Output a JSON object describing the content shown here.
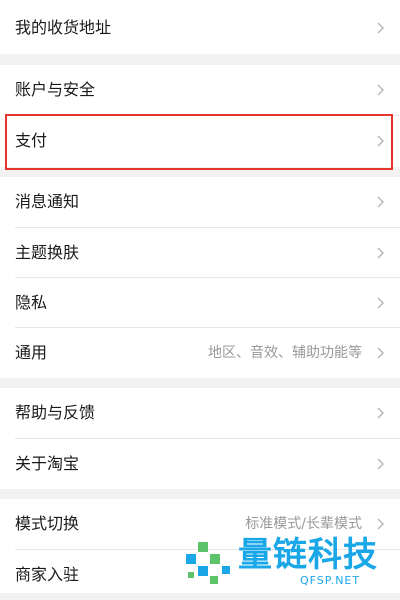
{
  "settings": {
    "groups": [
      {
        "items": [
          {
            "label": "我的收货地址",
            "value": ""
          }
        ]
      },
      {
        "items": [
          {
            "label": "账户与安全",
            "value": ""
          },
          {
            "label": "支付",
            "value": ""
          }
        ]
      },
      {
        "items": [
          {
            "label": "消息通知",
            "value": ""
          },
          {
            "label": "主题换肤",
            "value": ""
          },
          {
            "label": "隐私",
            "value": ""
          },
          {
            "label": "通用",
            "value": "地区、音效、辅助功能等"
          }
        ]
      },
      {
        "items": [
          {
            "label": "帮助与反馈",
            "value": ""
          },
          {
            "label": "关于淘宝",
            "value": ""
          }
        ]
      },
      {
        "items": [
          {
            "label": "模式切换",
            "value": "标准模式/长辈模式"
          },
          {
            "label": "商家入驻",
            "value": ""
          }
        ]
      }
    ]
  },
  "watermark": {
    "brand": "量链科技",
    "url": "QFSP.NET"
  },
  "colors": {
    "highlight": "#e5362b",
    "watermark": "#1aa7e8",
    "watermark_green": "#5cc36b"
  },
  "icons": {
    "chevron": "chevron-right-icon",
    "logo": "brand-logo-icon"
  }
}
